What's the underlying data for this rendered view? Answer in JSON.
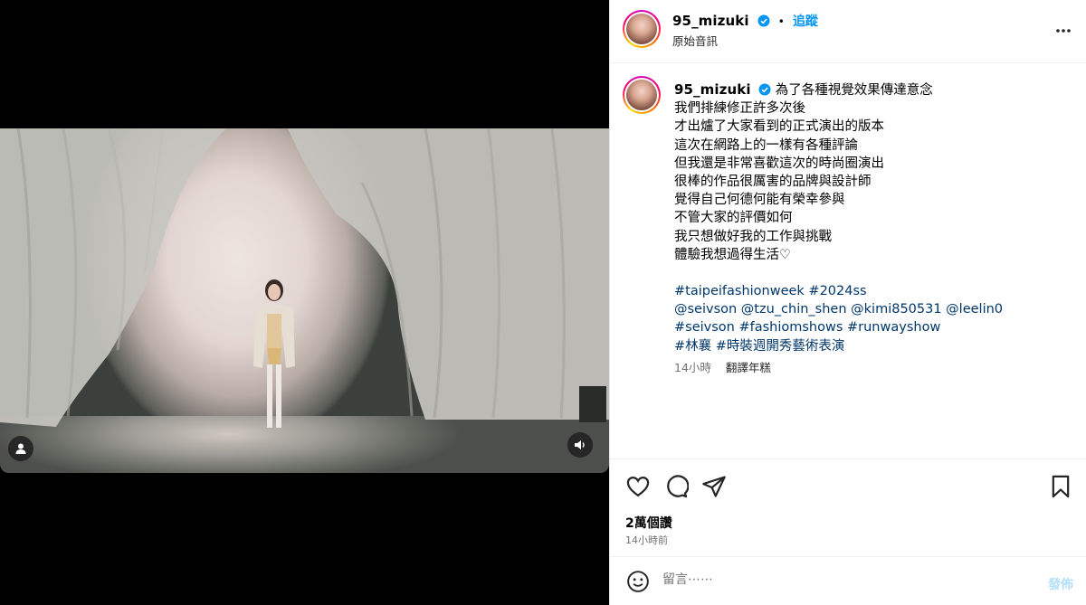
{
  "post": {
    "username": "95_mizuki",
    "follow_label": "追蹤",
    "separator": "•",
    "audio_label": "原始音訊",
    "more_icon": "more-horizontal-icon",
    "caption_lines": [
      "為了各種視覺效果傳達意念",
      "我們排練修正許多次後",
      "才出爐了大家看到的正式演出的版本",
      "這次在網路上的一樣有各種評論",
      "但我還是非常喜歡這次的時尚圈演出",
      "很棒的作品很厲害的品牌與設計師",
      "覺得自己何德何能有榮幸參與",
      "不管大家的評價如何",
      "我只想做好我的工作與挑戰",
      "體驗我想過得生活♡"
    ],
    "hashtag_lines": [
      "#taipeifashionweek #2024ss",
      "@seivson @tzu_chin_shen @kimi850531 @leelin0",
      "#seivson #fashiomshows #runwayshow",
      "#林襄 #時裝週開秀藝術表演"
    ],
    "caption_time": "14小時",
    "translate_label": "翻譯年糕",
    "views": "2萬個讚",
    "posted_time": "14小時前",
    "comment_placeholder": "留言⋯⋯",
    "post_label": "發佈"
  },
  "colors": {
    "accent": "#0095f6",
    "link": "#00376b",
    "muted": "#737373",
    "post_disabled": "#b2dffc"
  },
  "icons": [
    "like-heart-icon",
    "comment-icon",
    "share-icon",
    "save-bookmark-icon",
    "emoji-icon",
    "user-tag-icon",
    "volume-icon",
    "verified-badge-icon"
  ]
}
